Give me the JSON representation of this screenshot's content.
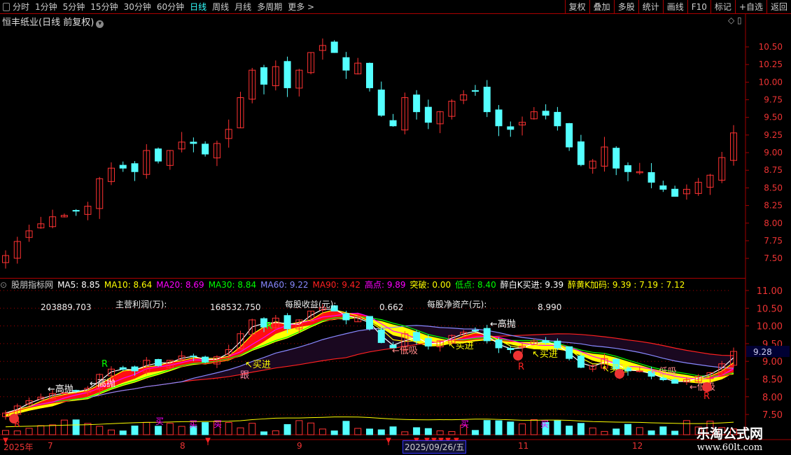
{
  "toolbar": {
    "periods": [
      "分时",
      "1分钟",
      "5分钟",
      "15分钟",
      "30分钟",
      "60分钟",
      "日线",
      "周线",
      "月线",
      "多周期",
      "更多 >"
    ],
    "active": "日线",
    "right_buttons": [
      "复权",
      "叠加",
      "多股",
      "统计",
      "画线",
      "F10",
      "标记",
      "+自选",
      "返回"
    ]
  },
  "stock_title": "恒丰纸业(日线 前复权)",
  "indicator": {
    "name": "股朋指标网",
    "values": [
      {
        "t": "MA5: 8.85",
        "c": "#ffffff"
      },
      {
        "t": "MA10: 8.64",
        "c": "#ffff00"
      },
      {
        "t": "MA20: 8.69",
        "c": "#ff00ff"
      },
      {
        "t": "MA30: 8.84",
        "c": "#00ff00"
      },
      {
        "t": "MA60: 9.22",
        "c": "#8888ff"
      },
      {
        "t": "MA90: 9.42",
        "c": "#ff2020"
      },
      {
        "t": "高点: 9.89",
        "c": "#ff00ff"
      },
      {
        "t": "突破: 0.00",
        "c": "#ffff00"
      },
      {
        "t": "低点: 8.40",
        "c": "#00ff00"
      },
      {
        "t": "醉白K买进: 9.39",
        "c": "#ffffff"
      },
      {
        "t": "醉黄K加码: 9.39 : 7.19 : 7.12",
        "c": "#ffff00"
      }
    ],
    "fin": {
      "v1": "203889.703",
      "l1": "主营利润(万):",
      "v2": "168532.750",
      "l2": "每股收益(元):",
      "v3": "0.662",
      "l3": "每股净资产(元):",
      "v4": "8.990"
    },
    "signals": [
      "高抛",
      "高抛",
      "高抛",
      "买进",
      "跟",
      "买进",
      "低吸",
      "买进",
      "高抛",
      "买进",
      "买进",
      "低吸",
      "低吸",
      "低吸",
      "R",
      "W"
    ],
    "buy_marks": [
      "买",
      "买",
      "买",
      "买",
      "买"
    ]
  },
  "upper_axis": [
    "10.50",
    "10.25",
    "10.00",
    "9.75",
    "9.50",
    "9.25",
    "9.00",
    "8.75",
    "8.50",
    "8.25",
    "8.00",
    "7.75",
    "7.50"
  ],
  "lower_axis": [
    "11.00",
    "10.50",
    "10.00",
    "9.50",
    "9.00",
    "8.50",
    "8.00",
    "7.50"
  ],
  "lower_current": "9.28",
  "dates": {
    "year": "2025年",
    "m7": "7",
    "m8": "8",
    "m9": "9",
    "selected": "2025/09/26/五",
    "m11": "11",
    "m12": "12"
  },
  "watermark": {
    "name": "乐淘公式网",
    "url": "www.60lt.com"
  },
  "colors": {
    "up": "#ff3232",
    "down": "#54ffff",
    "grid": "#a00000"
  },
  "chart_data": {
    "type": "candlestick",
    "closes": [
      7.54,
      7.74,
      7.89,
      7.99,
      8.09,
      8.11,
      8.17,
      8.24,
      8.63,
      8.78,
      8.78,
      8.73,
      9.03,
      8.88,
      9.03,
      9.15,
      9.13,
      8.98,
      9.13,
      9.33,
      9.78,
      10.17,
      9.97,
      10.22,
      9.92,
      10.17,
      10.42,
      10.52,
      10.42,
      10.17,
      10.27,
      9.92,
      9.53,
      9.38,
      9.78,
      9.58,
      9.43,
      9.58,
      9.73,
      9.82,
      9.87,
      9.58,
      9.38,
      9.33,
      9.43,
      9.58,
      9.53,
      9.38,
      9.08,
      8.83,
      8.88,
      9.08,
      8.78,
      8.73,
      8.73,
      8.58,
      8.48,
      8.38,
      8.48,
      8.58,
      8.68,
      8.93,
      9.28
    ],
    "ylim": [
      7.35,
      10.7
    ]
  }
}
